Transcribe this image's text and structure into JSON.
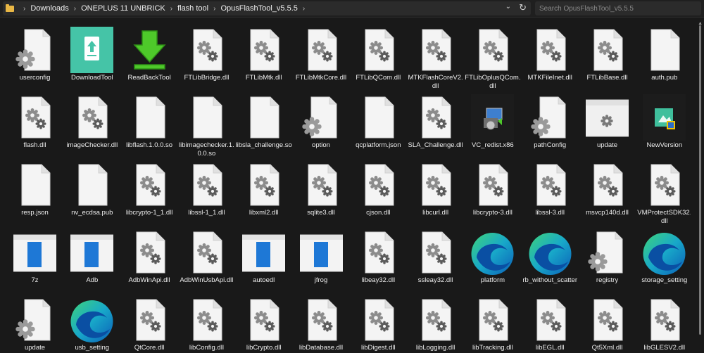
{
  "breadcrumb": [
    "Downloads",
    "ONEPLUS 11 UNBRICK",
    "flash tool",
    "OpusFlashTool_v5.5.5"
  ],
  "search": {
    "placeholder": "Search OpusFlashTool_v5.5.5"
  },
  "icons": {
    "folder": "folder-icon",
    "dropdown": "chevron-down-icon",
    "refresh": "refresh-icon"
  },
  "files": [
    {
      "name": "userconfig",
      "icon": "gear-big"
    },
    {
      "name": "DownloadTool",
      "icon": "download-tool"
    },
    {
      "name": "ReadBackTool",
      "icon": "green-arrow"
    },
    {
      "name": "FTLibBridge.dll",
      "icon": "dll"
    },
    {
      "name": "FTLibMtk.dll",
      "icon": "dll"
    },
    {
      "name": "FTLibMtkCore.dll",
      "icon": "dll"
    },
    {
      "name": "FTLibQCom.dll",
      "icon": "dll"
    },
    {
      "name": "MTKFlashCoreV2.dll",
      "icon": "dll"
    },
    {
      "name": "FTLibOplusQCom.dll",
      "icon": "dll"
    },
    {
      "name": "MTKFileInet.dll",
      "icon": "dll"
    },
    {
      "name": "FTLibBase.dll",
      "icon": "dll"
    },
    {
      "name": "auth.pub",
      "icon": "blank"
    },
    {
      "name": "flash.dll",
      "icon": "dll"
    },
    {
      "name": "imageChecker.dll",
      "icon": "dll"
    },
    {
      "name": "libflash.1.0.0.so",
      "icon": "blank"
    },
    {
      "name": "libimagechecker.1.0.0.so",
      "icon": "blank"
    },
    {
      "name": "libsla_challenge.so",
      "icon": "blank"
    },
    {
      "name": "option",
      "icon": "gear-big"
    },
    {
      "name": "qcplatform.json",
      "icon": "blank"
    },
    {
      "name": "SLA_Challenge.dll",
      "icon": "dll"
    },
    {
      "name": "VC_redist.x86",
      "icon": "installer"
    },
    {
      "name": "pathConfig",
      "icon": "gear-big"
    },
    {
      "name": "update",
      "icon": "window-gear"
    },
    {
      "name": "NewVersion",
      "icon": "newversion"
    },
    {
      "name": "resp.json",
      "icon": "blank"
    },
    {
      "name": "nv_ecdsa.pub",
      "icon": "blank"
    },
    {
      "name": "libcrypto-1_1.dll",
      "icon": "dll"
    },
    {
      "name": "libssl-1_1.dll",
      "icon": "dll"
    },
    {
      "name": "libxml2.dll",
      "icon": "dll"
    },
    {
      "name": "sqlite3.dll",
      "icon": "dll"
    },
    {
      "name": "cjson.dll",
      "icon": "dll"
    },
    {
      "name": "libcurl.dll",
      "icon": "dll"
    },
    {
      "name": "libcrypto-3.dll",
      "icon": "dll"
    },
    {
      "name": "libssl-3.dll",
      "icon": "dll"
    },
    {
      "name": "msvcp140d.dll",
      "icon": "dll"
    },
    {
      "name": "VMProtectSDK32.dll",
      "icon": "dll"
    },
    {
      "name": "7z",
      "icon": "app-window"
    },
    {
      "name": "Adb",
      "icon": "app-window"
    },
    {
      "name": "AdbWinApi.dll",
      "icon": "dll"
    },
    {
      "name": "AdbWinUsbApi.dll",
      "icon": "dll"
    },
    {
      "name": "autoedl",
      "icon": "app-window"
    },
    {
      "name": "jfrog",
      "icon": "app-window"
    },
    {
      "name": "libeay32.dll",
      "icon": "dll"
    },
    {
      "name": "ssleay32.dll",
      "icon": "dll"
    },
    {
      "name": "platform",
      "icon": "edge"
    },
    {
      "name": "rb_without_scatter",
      "icon": "edge"
    },
    {
      "name": "registry",
      "icon": "gear-big"
    },
    {
      "name": "storage_setting",
      "icon": "edge"
    },
    {
      "name": "update",
      "icon": "gear-big"
    },
    {
      "name": "usb_setting",
      "icon": "edge"
    },
    {
      "name": "QtCore.dll",
      "icon": "dll"
    },
    {
      "name": "libConfig.dll",
      "icon": "dll"
    },
    {
      "name": "libCrypto.dll",
      "icon": "dll"
    },
    {
      "name": "libDatabase.dll",
      "icon": "dll"
    },
    {
      "name": "libDigest.dll",
      "icon": "dll"
    },
    {
      "name": "libLogging.dll",
      "icon": "dll"
    },
    {
      "name": "libTracking.dll",
      "icon": "dll"
    },
    {
      "name": "libEGL.dll",
      "icon": "dll"
    },
    {
      "name": "Qt5Xml.dll",
      "icon": "dll"
    },
    {
      "name": "libGLESV2.dll",
      "icon": "dll"
    }
  ]
}
